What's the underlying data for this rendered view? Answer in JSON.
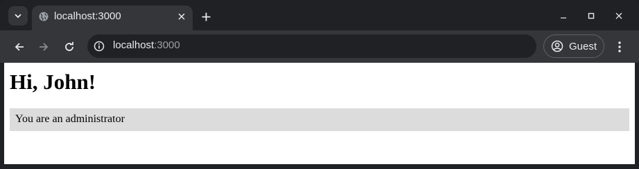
{
  "tab": {
    "title": "localhost:3000"
  },
  "toolbar": {
    "url_host": "localhost",
    "url_port": ":3000",
    "profile_label": "Guest"
  },
  "page": {
    "heading": "Hi, John!",
    "role_message": "You are an administrator"
  },
  "icons": {
    "tab_search": "chevron-down-icon",
    "favicon": "globe-icon",
    "tab_close": "close-icon",
    "new_tab": "plus-icon",
    "minimize": "minimize-icon",
    "maximize": "maximize-icon",
    "close_window": "close-icon",
    "back": "arrow-left-icon",
    "forward": "arrow-right-icon",
    "reload": "reload-icon",
    "site_info": "info-icon",
    "profile": "person-circle-icon",
    "menu": "kebab-menu-icon"
  },
  "colors": {
    "frame": "#202124",
    "toolbar": "#35363a",
    "text": "#e8eaed",
    "muted": "#9aa0a6",
    "role_box": "#dcdcdc"
  }
}
